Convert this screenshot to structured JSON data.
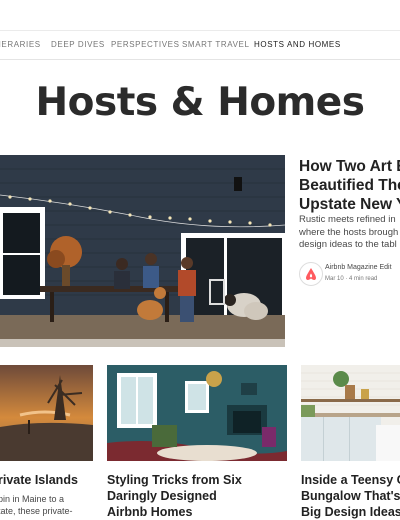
{
  "nav": {
    "items": [
      {
        "label": "NERARIES",
        "active": false
      },
      {
        "label": "DEEP DIVES",
        "active": false
      },
      {
        "label": "PERSPECTIVES",
        "active": false
      },
      {
        "label": "SMART TRAVEL",
        "active": false
      },
      {
        "label": "HOSTS AND HOMES",
        "active": true
      }
    ]
  },
  "page": {
    "title": "Hosts & Homes"
  },
  "featured": {
    "title_lines": [
      "How Two Art E",
      "Beautified The",
      "Upstate New Y"
    ],
    "description_lines": [
      "Rustic meets refined in",
      "where the hosts brough",
      "design ideas to the tabl"
    ],
    "author": "Airbnb Magazine Edit",
    "date": "Mar 10",
    "read_time": "4 min read",
    "icon": "airbnb-logo-icon"
  },
  "cards": [
    {
      "title_lines": [
        "rivate Islands"
      ],
      "description_lines": [
        "pin in Maine to a",
        "tate, these private-"
      ],
      "image": "island-sunset-photo"
    },
    {
      "title_lines": [
        "Styling Tricks from Six",
        "Daringly Designed",
        "Airbnb Homes"
      ],
      "description_lines": [],
      "image": "teal-living-room-photo"
    },
    {
      "title_lines": [
        "Inside a Teensy C",
        "Bungalow That's I",
        "Big Design Ideas"
      ],
      "description_lines": [],
      "image": "white-kitchen-photo"
    }
  ],
  "colors": {
    "accent": "#ff5a5f",
    "text": "#222222",
    "muted": "#767676"
  }
}
